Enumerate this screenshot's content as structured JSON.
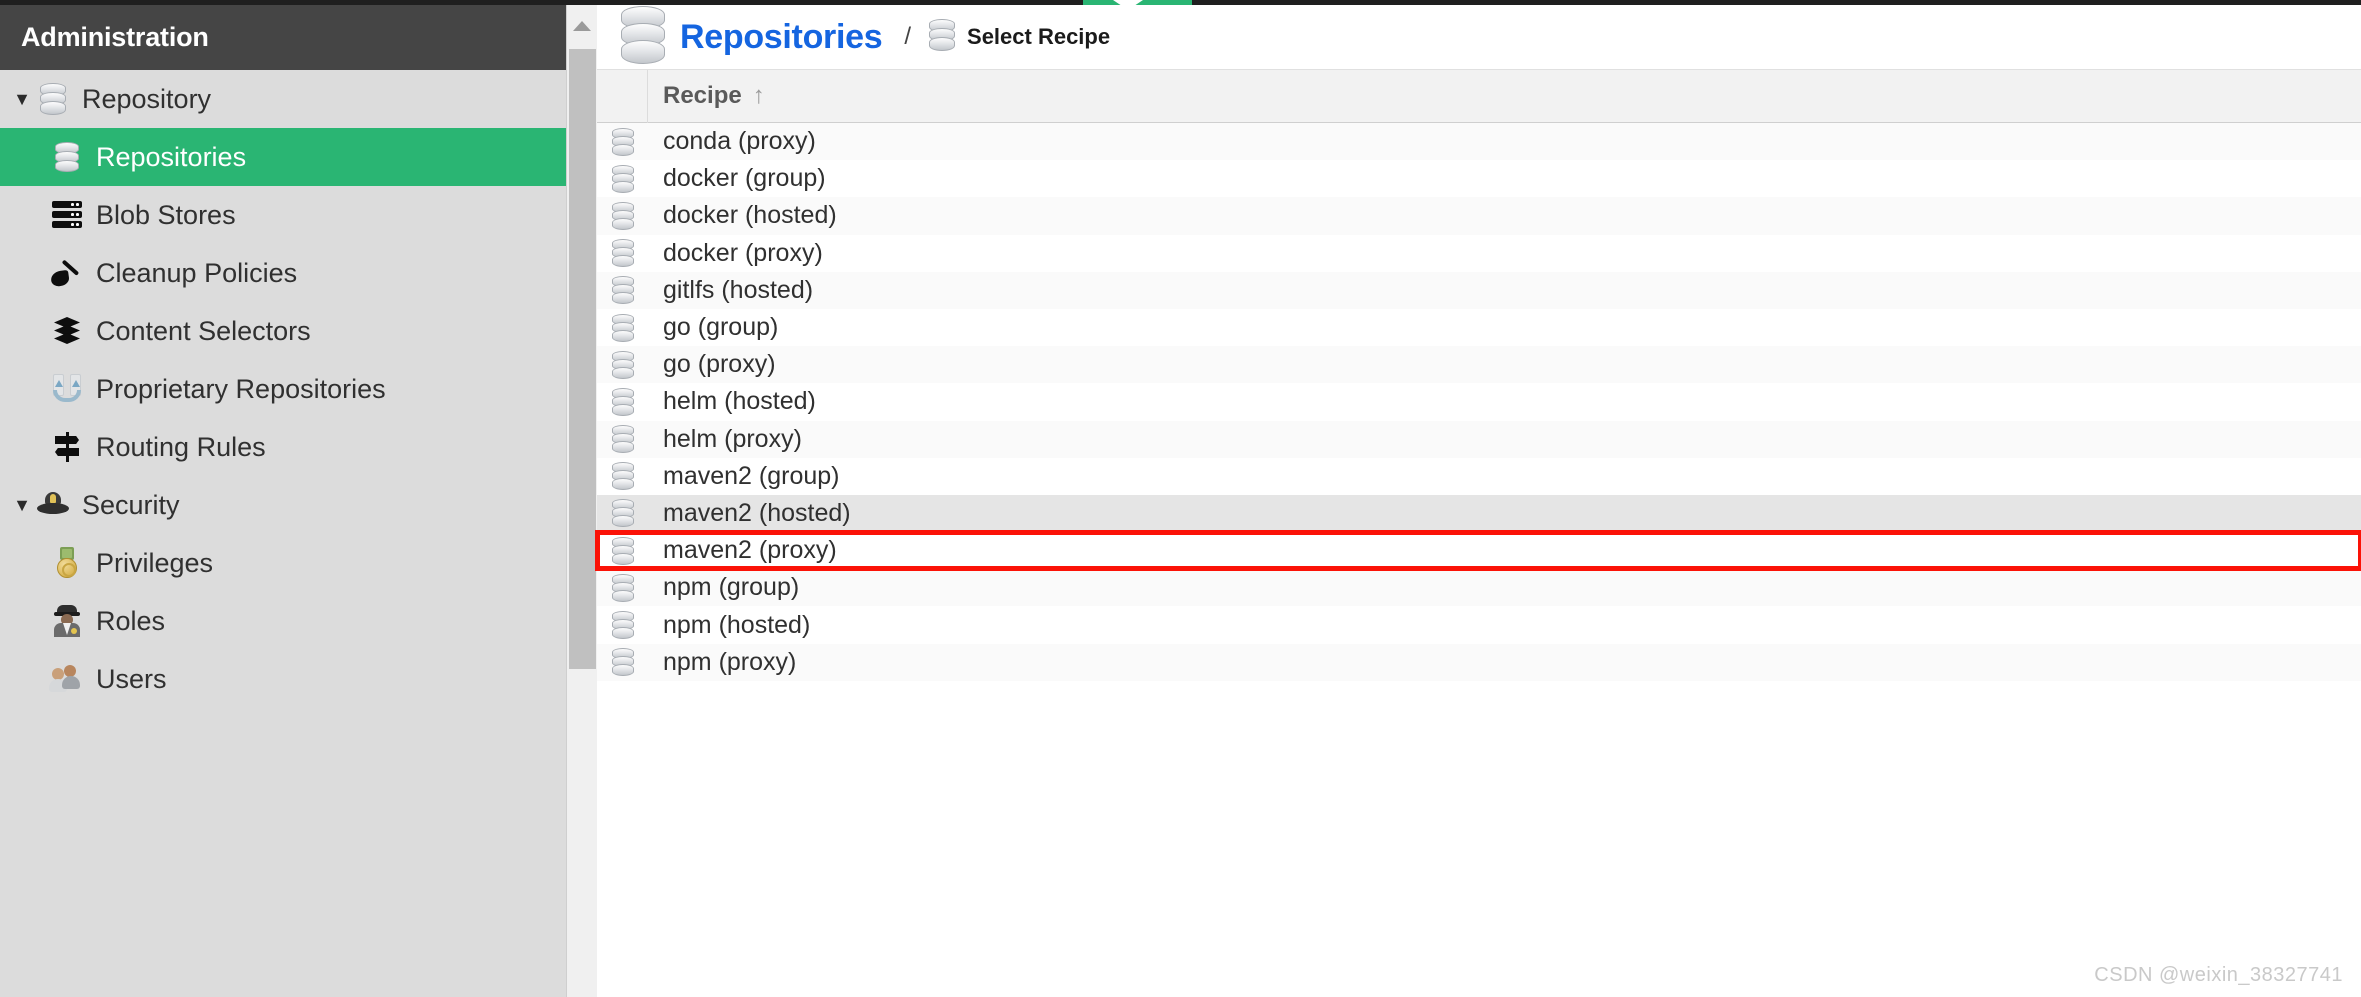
{
  "window": {
    "accent_green": "#2ab573",
    "link_blue": "#1565e0",
    "highlight_red": "#fb1207",
    "header_dark": "#454545",
    "sidebar_bg": "#dcdcdc"
  },
  "sidebar": {
    "title": "Administration",
    "items": [
      {
        "label": "Repository",
        "icon": "database-icon",
        "level": "group",
        "caret": "▼",
        "selected": false
      },
      {
        "label": "Repositories",
        "icon": "database-icon",
        "level": "child",
        "caret": "",
        "selected": true
      },
      {
        "label": "Blob Stores",
        "icon": "blob-stores-icon",
        "level": "child",
        "caret": "",
        "selected": false
      },
      {
        "label": "Cleanup Policies",
        "icon": "broom-icon",
        "level": "child",
        "caret": "",
        "selected": false
      },
      {
        "label": "Content Selectors",
        "icon": "layers-icon",
        "level": "child",
        "caret": "",
        "selected": false
      },
      {
        "label": "Proprietary Repositories",
        "icon": "proprietary-icon",
        "level": "child",
        "caret": "",
        "selected": false
      },
      {
        "label": "Routing Rules",
        "icon": "signpost-icon",
        "level": "child",
        "caret": "",
        "selected": false
      },
      {
        "label": "Security",
        "icon": "security-cap-icon",
        "level": "group",
        "caret": "▼",
        "selected": false
      },
      {
        "label": "Privileges",
        "icon": "medal-icon",
        "level": "child",
        "caret": "",
        "selected": false
      },
      {
        "label": "Roles",
        "icon": "roles-icon",
        "level": "child",
        "caret": "",
        "selected": false
      },
      {
        "label": "Users",
        "icon": "users-icon",
        "level": "child",
        "caret": "",
        "selected": false
      }
    ]
  },
  "breadcrumb": {
    "root_label": "Repositories",
    "root_icon": "database-icon",
    "separator": "/",
    "current_label": "Select Recipe",
    "current_icon": "database-icon"
  },
  "table": {
    "column_header": "Recipe",
    "sort_indicator": "↑",
    "rows": [
      {
        "label": "conda (proxy)",
        "icon": "database-icon",
        "state": "alt"
      },
      {
        "label": "docker (group)",
        "icon": "database-icon",
        "state": "normal"
      },
      {
        "label": "docker (hosted)",
        "icon": "database-icon",
        "state": "alt"
      },
      {
        "label": "docker (proxy)",
        "icon": "database-icon",
        "state": "normal"
      },
      {
        "label": "gitlfs (hosted)",
        "icon": "database-icon",
        "state": "alt"
      },
      {
        "label": "go (group)",
        "icon": "database-icon",
        "state": "normal"
      },
      {
        "label": "go (proxy)",
        "icon": "database-icon",
        "state": "alt"
      },
      {
        "label": "helm (hosted)",
        "icon": "database-icon",
        "state": "normal"
      },
      {
        "label": "helm (proxy)",
        "icon": "database-icon",
        "state": "alt"
      },
      {
        "label": "maven2 (group)",
        "icon": "database-icon",
        "state": "normal"
      },
      {
        "label": "maven2 (hosted)",
        "icon": "database-icon",
        "state": "hovered"
      },
      {
        "label": "maven2 (proxy)",
        "icon": "database-icon",
        "state": "boxed"
      },
      {
        "label": "npm (group)",
        "icon": "database-icon",
        "state": "alt"
      },
      {
        "label": "npm (hosted)",
        "icon": "database-icon",
        "state": "normal"
      },
      {
        "label": "npm (proxy)",
        "icon": "database-icon",
        "state": "alt"
      }
    ]
  },
  "watermark": "CSDN @weixin_38327741"
}
